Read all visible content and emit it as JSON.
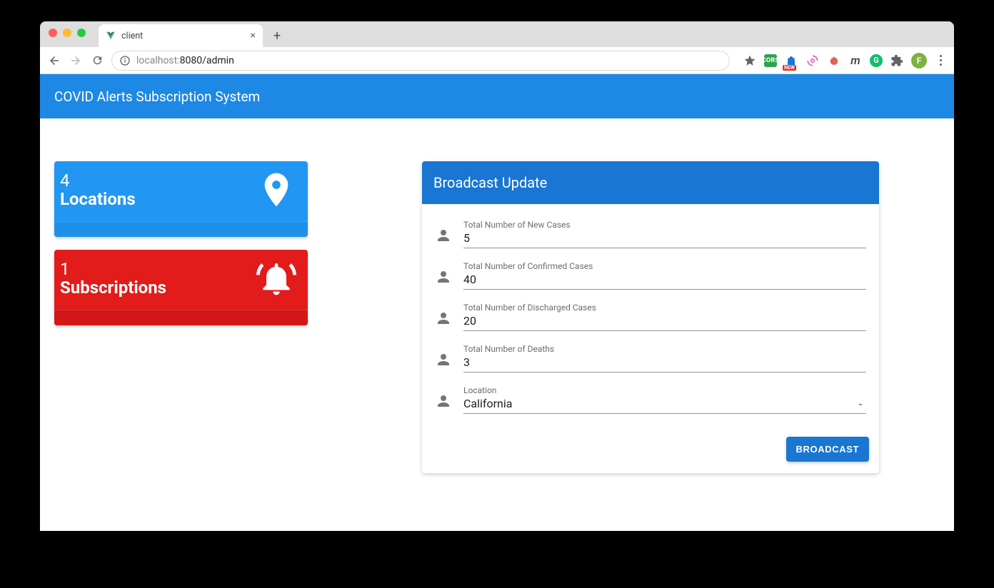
{
  "browser": {
    "tab_title": "client",
    "url_display_host": "localhost:",
    "url_display_port_path": "8080/admin"
  },
  "appbar": {
    "title": "COVID Alerts Subscription System"
  },
  "stats": {
    "locations": {
      "count": "4",
      "label": "Locations"
    },
    "subscriptions": {
      "count": "1",
      "label": "Subscriptions"
    }
  },
  "form": {
    "title": "Broadcast Update",
    "fields": {
      "new_cases": {
        "label": "Total Number of New Cases",
        "value": "5"
      },
      "confirmed_cases": {
        "label": "Total Number of Confirmed Cases",
        "value": "40"
      },
      "discharged_cases": {
        "label": "Total Number of Discharged Cases",
        "value": "20"
      },
      "deaths": {
        "label": "Total Number of Deaths",
        "value": "3"
      },
      "location": {
        "label": "Location",
        "value": "California"
      }
    },
    "submit_label": "BROADCAST"
  }
}
